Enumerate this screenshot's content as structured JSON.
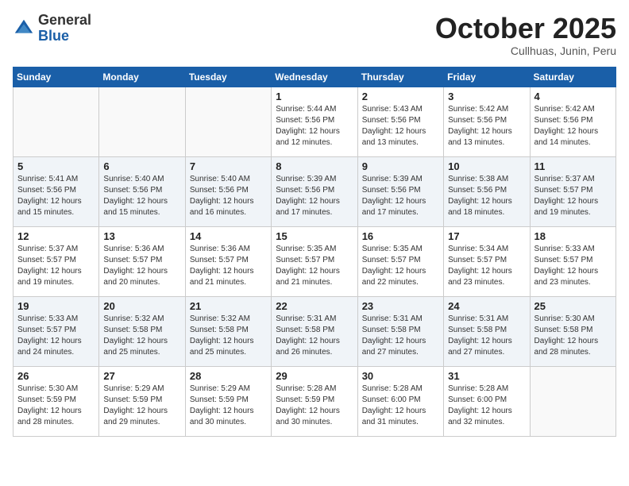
{
  "header": {
    "logo_general": "General",
    "logo_blue": "Blue",
    "month": "October 2025",
    "location": "Cullhuas, Junin, Peru"
  },
  "weekdays": [
    "Sunday",
    "Monday",
    "Tuesday",
    "Wednesday",
    "Thursday",
    "Friday",
    "Saturday"
  ],
  "weeks": [
    [
      {
        "day": null,
        "sunrise": null,
        "sunset": null,
        "daylight": null
      },
      {
        "day": null,
        "sunrise": null,
        "sunset": null,
        "daylight": null
      },
      {
        "day": null,
        "sunrise": null,
        "sunset": null,
        "daylight": null
      },
      {
        "day": "1",
        "sunrise": "5:44 AM",
        "sunset": "5:56 PM",
        "daylight": "12 hours and 12 minutes."
      },
      {
        "day": "2",
        "sunrise": "5:43 AM",
        "sunset": "5:56 PM",
        "daylight": "12 hours and 13 minutes."
      },
      {
        "day": "3",
        "sunrise": "5:42 AM",
        "sunset": "5:56 PM",
        "daylight": "12 hours and 13 minutes."
      },
      {
        "day": "4",
        "sunrise": "5:42 AM",
        "sunset": "5:56 PM",
        "daylight": "12 hours and 14 minutes."
      }
    ],
    [
      {
        "day": "5",
        "sunrise": "5:41 AM",
        "sunset": "5:56 PM",
        "daylight": "12 hours and 15 minutes."
      },
      {
        "day": "6",
        "sunrise": "5:40 AM",
        "sunset": "5:56 PM",
        "daylight": "12 hours and 15 minutes."
      },
      {
        "day": "7",
        "sunrise": "5:40 AM",
        "sunset": "5:56 PM",
        "daylight": "12 hours and 16 minutes."
      },
      {
        "day": "8",
        "sunrise": "5:39 AM",
        "sunset": "5:56 PM",
        "daylight": "12 hours and 17 minutes."
      },
      {
        "day": "9",
        "sunrise": "5:39 AM",
        "sunset": "5:56 PM",
        "daylight": "12 hours and 17 minutes."
      },
      {
        "day": "10",
        "sunrise": "5:38 AM",
        "sunset": "5:56 PM",
        "daylight": "12 hours and 18 minutes."
      },
      {
        "day": "11",
        "sunrise": "5:37 AM",
        "sunset": "5:57 PM",
        "daylight": "12 hours and 19 minutes."
      }
    ],
    [
      {
        "day": "12",
        "sunrise": "5:37 AM",
        "sunset": "5:57 PM",
        "daylight": "12 hours and 19 minutes."
      },
      {
        "day": "13",
        "sunrise": "5:36 AM",
        "sunset": "5:57 PM",
        "daylight": "12 hours and 20 minutes."
      },
      {
        "day": "14",
        "sunrise": "5:36 AM",
        "sunset": "5:57 PM",
        "daylight": "12 hours and 21 minutes."
      },
      {
        "day": "15",
        "sunrise": "5:35 AM",
        "sunset": "5:57 PM",
        "daylight": "12 hours and 21 minutes."
      },
      {
        "day": "16",
        "sunrise": "5:35 AM",
        "sunset": "5:57 PM",
        "daylight": "12 hours and 22 minutes."
      },
      {
        "day": "17",
        "sunrise": "5:34 AM",
        "sunset": "5:57 PM",
        "daylight": "12 hours and 23 minutes."
      },
      {
        "day": "18",
        "sunrise": "5:33 AM",
        "sunset": "5:57 PM",
        "daylight": "12 hours and 23 minutes."
      }
    ],
    [
      {
        "day": "19",
        "sunrise": "5:33 AM",
        "sunset": "5:57 PM",
        "daylight": "12 hours and 24 minutes."
      },
      {
        "day": "20",
        "sunrise": "5:32 AM",
        "sunset": "5:58 PM",
        "daylight": "12 hours and 25 minutes."
      },
      {
        "day": "21",
        "sunrise": "5:32 AM",
        "sunset": "5:58 PM",
        "daylight": "12 hours and 25 minutes."
      },
      {
        "day": "22",
        "sunrise": "5:31 AM",
        "sunset": "5:58 PM",
        "daylight": "12 hours and 26 minutes."
      },
      {
        "day": "23",
        "sunrise": "5:31 AM",
        "sunset": "5:58 PM",
        "daylight": "12 hours and 27 minutes."
      },
      {
        "day": "24",
        "sunrise": "5:31 AM",
        "sunset": "5:58 PM",
        "daylight": "12 hours and 27 minutes."
      },
      {
        "day": "25",
        "sunrise": "5:30 AM",
        "sunset": "5:58 PM",
        "daylight": "12 hours and 28 minutes."
      }
    ],
    [
      {
        "day": "26",
        "sunrise": "5:30 AM",
        "sunset": "5:59 PM",
        "daylight": "12 hours and 28 minutes."
      },
      {
        "day": "27",
        "sunrise": "5:29 AM",
        "sunset": "5:59 PM",
        "daylight": "12 hours and 29 minutes."
      },
      {
        "day": "28",
        "sunrise": "5:29 AM",
        "sunset": "5:59 PM",
        "daylight": "12 hours and 30 minutes."
      },
      {
        "day": "29",
        "sunrise": "5:28 AM",
        "sunset": "5:59 PM",
        "daylight": "12 hours and 30 minutes."
      },
      {
        "day": "30",
        "sunrise": "5:28 AM",
        "sunset": "6:00 PM",
        "daylight": "12 hours and 31 minutes."
      },
      {
        "day": "31",
        "sunrise": "5:28 AM",
        "sunset": "6:00 PM",
        "daylight": "12 hours and 32 minutes."
      },
      {
        "day": null,
        "sunrise": null,
        "sunset": null,
        "daylight": null
      }
    ]
  ],
  "labels": {
    "sunrise": "Sunrise: ",
    "sunset": "Sunset: ",
    "daylight": "Daylight: "
  }
}
